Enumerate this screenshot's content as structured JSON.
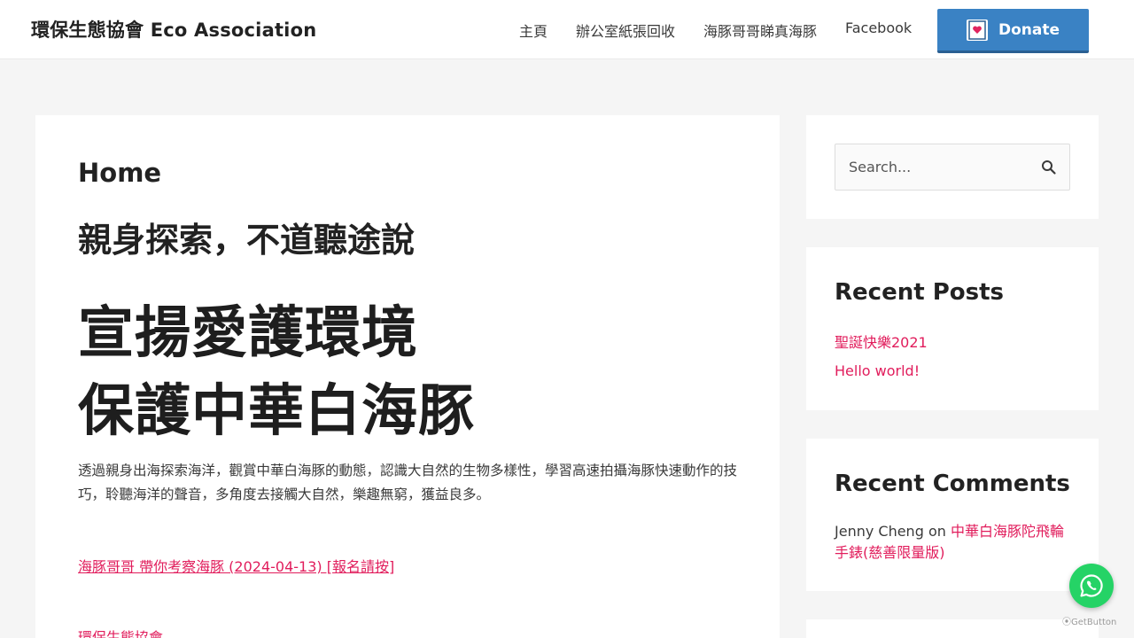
{
  "header": {
    "site_title": "環保生態協會 Eco Association",
    "nav": [
      {
        "label": "主頁"
      },
      {
        "label": "辦公室紙張回收"
      },
      {
        "label": "海豚哥哥睇真海豚"
      },
      {
        "label": "Facebook"
      }
    ],
    "donate_label": "Donate",
    "donate_icon": "donate-heart-icon"
  },
  "main": {
    "page_title": "Home",
    "subheading": "親身探索，不道聽途說",
    "hero_lines": [
      "宣揚愛護環境",
      "保護中華白海豚"
    ],
    "intro": "透過親身出海探索海洋，觀賞中華白海豚的動態，認識大自然的生物多樣性，學習高速拍攝海豚快速動作的技巧，聆聽海洋的聲音，多角度去接觸大自然，樂趣無窮，獲益良多。",
    "event_link": "海豚哥哥 帶你考察海豚 (2024-04-13) [報名請按]",
    "org_link": "環保生態協會"
  },
  "sidebar": {
    "search": {
      "placeholder": "Search...",
      "icon": "search-icon"
    },
    "recent_posts": {
      "title": "Recent Posts",
      "items": [
        {
          "label": "聖誕快樂2021"
        },
        {
          "label": "Hello world!"
        }
      ]
    },
    "recent_comments": {
      "title": "Recent Comments",
      "author": "Jenny Cheng",
      "connector": "on",
      "post": "中華白海豚陀飛輪手錶(慈善限量版)"
    }
  },
  "floating": {
    "whatsapp_icon": "whatsapp-icon",
    "getbutton_label": "GetButton"
  },
  "colors": {
    "accent_link": "#e11d5c",
    "donate_bg": "#3a82c4",
    "whatsapp": "#25d366",
    "page_bg": "#f5f5f5"
  }
}
